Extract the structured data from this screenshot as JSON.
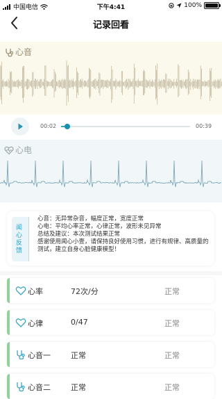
{
  "status_bar": {
    "carrier": "中国电信",
    "time": "下午4:41",
    "battery": "100%"
  },
  "nav": {
    "title": "记录回看"
  },
  "heart_sound": {
    "label": "心音"
  },
  "player": {
    "current": "00:02",
    "duration": "00:39",
    "progress": 0.05
  },
  "ecg": {
    "label": "心电"
  },
  "feedback": {
    "tag": "闻心反馈",
    "lines": [
      "心音：无异常杂音，幅度正常，宽度正常",
      "心电：平均心率正常，心律正常，波形未见异常",
      "总结及建议：本次测试结果正常",
      "感谢使用闻心小壹，请保持良好使用习惯，进行有规律、高质量的测试，建立自身心脏健康模型！"
    ]
  },
  "metrics": [
    {
      "icon": "heart-outline-icon",
      "name": "心率",
      "value": "72次/分",
      "status": "正常"
    },
    {
      "icon": "heart-outline-icon",
      "name": "心律",
      "value": "0/47",
      "status": "正常"
    },
    {
      "icon": "stethoscope-icon",
      "name": "心音一",
      "value": "正常",
      "status": "正常"
    },
    {
      "icon": "stethoscope-icon",
      "name": "心音二",
      "value": "正常",
      "status": "正常"
    }
  ]
}
